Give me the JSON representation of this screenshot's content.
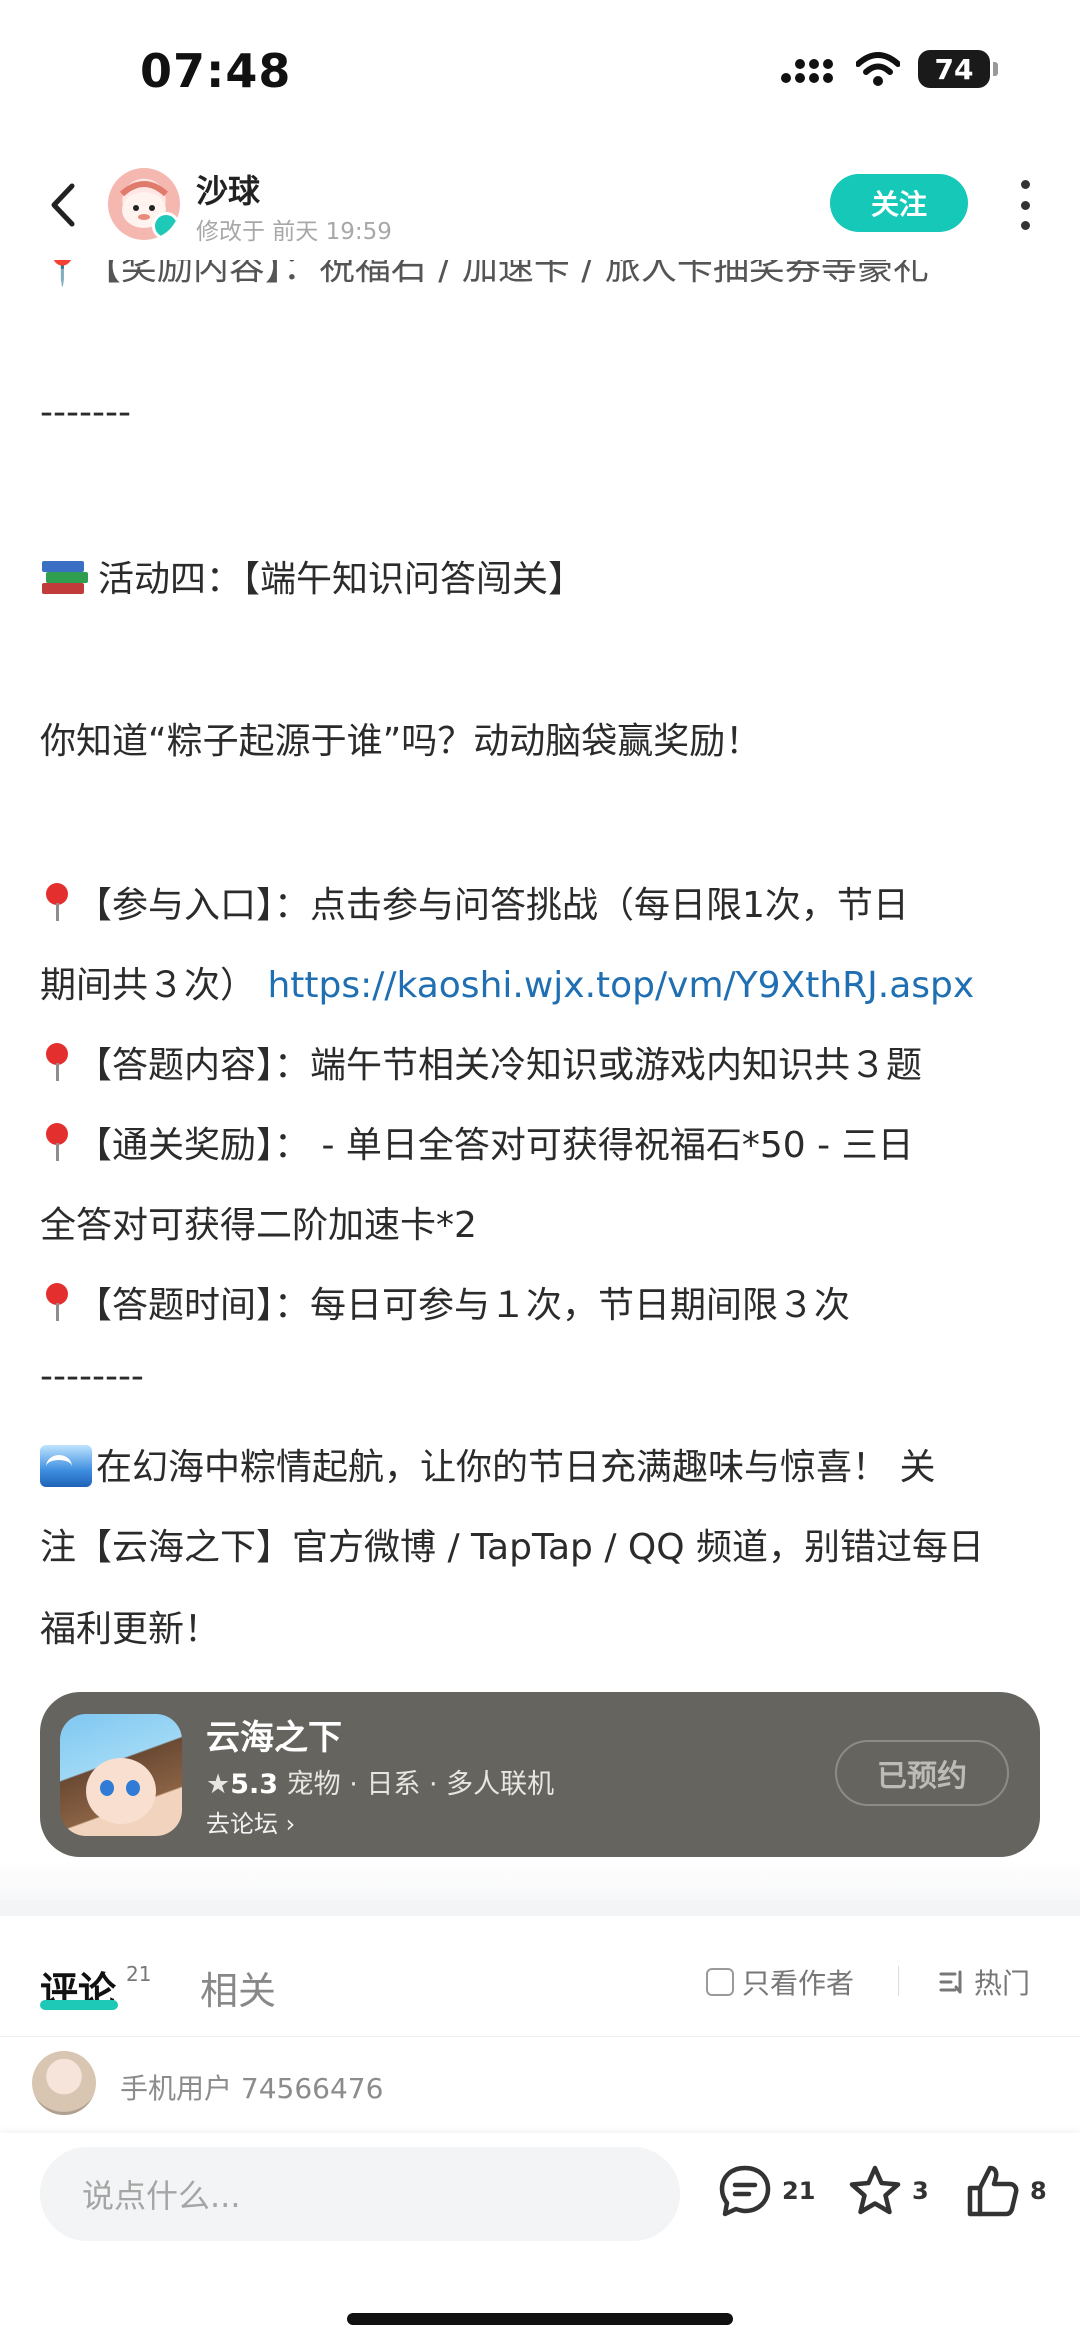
{
  "status_bar": {
    "time": "07:48",
    "battery": "74"
  },
  "header": {
    "author_name": "沙球",
    "author_meta": "修改于 前天 19:59",
    "follow_label": "关注"
  },
  "article": {
    "partial_top": "📍【奖励内容】：祝福石 / 加速卡 / 旅人卡抽奖券等豪礼",
    "divider1": "-------",
    "activity_title": "活动四：【端午知识问答闯关】",
    "intro": "你知道“粽子起源于谁”吗？动动脑袋赢奖励！",
    "entry_line1": "【参与入口】：点击参与问答挑战（每日限1次，节日",
    "entry_line2_text": "期间共３次）",
    "entry_link": "https://kaoshi.wjx.top/vm/Y9XthRJ.aspx",
    "content_line": "【答题内容】：端午节相关冷知识或游戏内知识共３题",
    "reward_line1": "【通关奖励】： - 单日全答对可获得祝福石*50 - 三日",
    "reward_line2": "全答对可获得二阶加速卡*2",
    "time_line": "【答题时间】：每日可参与１次，节日期间限３次",
    "divider2": "--------",
    "closing_line1": "在幻海中粽情起航，让你的节日充满趣味与惊喜！ 关",
    "closing_line2": "注【云海之下】官方微博 / TapTap / QQ 频道，别错过每日",
    "closing_line3": "福利更新！"
  },
  "game_card": {
    "title": "云海之下",
    "score": "5.3",
    "tags": "宠物 · 日系 · 多人联机",
    "forum_link": "去论坛",
    "reserved_label": "已预约"
  },
  "comments": {
    "tab_comment": "评论",
    "tab_comment_count": "21",
    "tab_related": "相关",
    "only_author": "只看作者",
    "hot_sort": "热门",
    "first_commenter": "手机用户 74566476"
  },
  "bottom_bar": {
    "input_placeholder": "说点什么...",
    "comment_count": "21",
    "favorite_count": "3",
    "like_count": "8"
  },
  "colors": {
    "accent": "#15c8b8",
    "link": "#1f6fb2",
    "card_bg": "#66645f"
  }
}
